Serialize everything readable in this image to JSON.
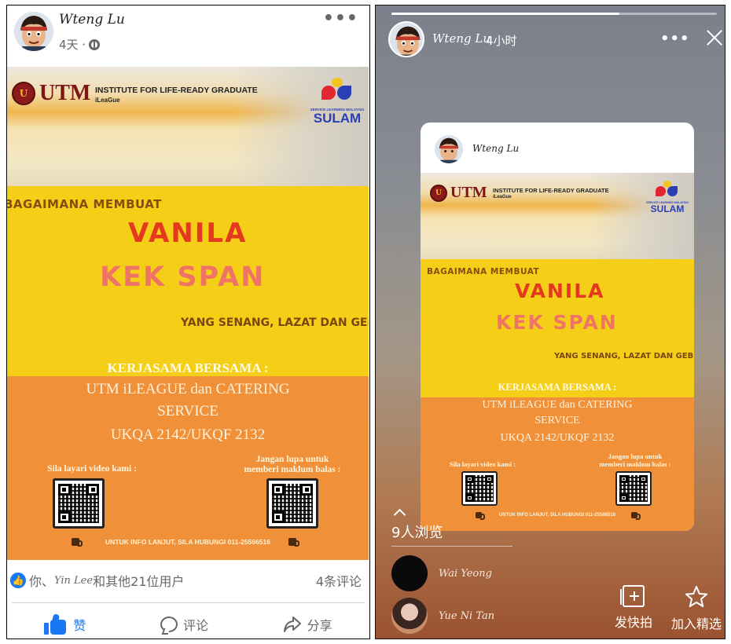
{
  "post": {
    "author": "Wteng Lu",
    "meta_time": "4天 ·",
    "more_label": "•••",
    "reactions_prefix": "你、",
    "reactions_name": "Yin Lee",
    "reactions_suffix": "和其他21位用户",
    "comments_count": "4条评论",
    "actions": {
      "like": "赞",
      "comment": "评论",
      "share": "分享"
    },
    "icons": {
      "more": "more-dots-icon",
      "globe": "globe-icon",
      "like": "thumbs-up-icon",
      "comment": "comment-bubble-icon",
      "share": "share-arrow-icon"
    }
  },
  "poster": {
    "inst_title": "INSTITUTE FOR LIFE-READY GRADUATE",
    "inst_sub": "iLeaGue",
    "utm": "UTM",
    "sulam_small": "SERVICE LEARNING MALAYSIA",
    "sulam_big": "SULAM",
    "bagaimana": "BAGAIMANA MEMBUAT",
    "vanila": "VANILA",
    "kek_span": "KEK SPAN",
    "tagline": "YANG SENANG, LAZAT DAN GEBU",
    "kerjasama": "KERJASAMA BERSAMA :",
    "collab_line1": "UTM iLEAGUE dan CATERING",
    "collab_line2": "SERVICE",
    "collab_line3": "UKQA 2142/UKQF 2132",
    "qr_left_caption": "Sila layari video kami :",
    "qr_right_caption_1": "Jangan lupa untuk",
    "qr_right_caption_2": "memberi maklum balas :",
    "footer": "UNTUK INFO LANJUT, SILA HUBUNGI 011-25566516"
  },
  "story": {
    "progress": 0.7,
    "author": "Wteng Lu",
    "time": "4小时",
    "more_label": "•••",
    "card_author": "Wteng Lu",
    "viewers_count": "9人浏览",
    "viewers": [
      {
        "name": "Wai Yeong"
      },
      {
        "name": "Yue Ni Tan"
      }
    ],
    "actions": {
      "snap": "发快拍",
      "feature": "加入精选"
    },
    "icons": {
      "close": "close-x-icon",
      "more": "more-dots-icon",
      "expand": "chevron-up-icon",
      "snap": "add-story-icon",
      "feature": "star-icon"
    }
  },
  "colors": {
    "fb_blue": "#1877f2",
    "poster_yellow": "#f5cf17",
    "poster_orange": "#f0913a",
    "vanila_red": "#e5391f",
    "kek_pink": "#f07465"
  }
}
